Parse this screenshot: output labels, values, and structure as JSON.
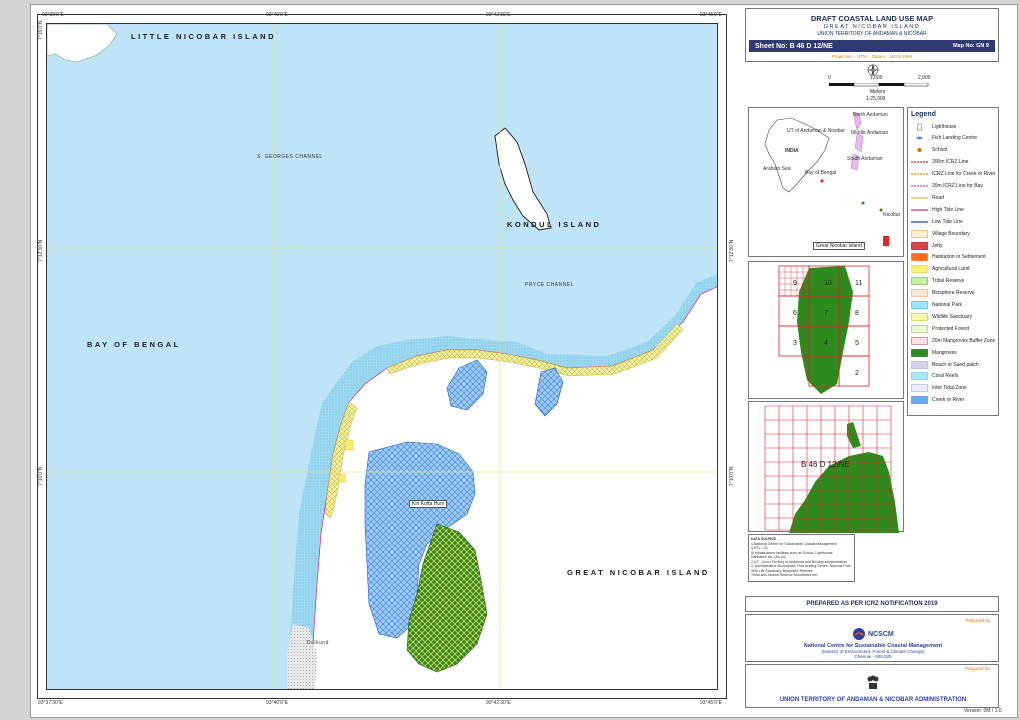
{
  "header": {
    "title": "DRAFT COASTAL LAND USE MAP",
    "island": "GREAT NICOBAR ISLAND",
    "territory": "UNION TERRITORY OF ANDAMAN & NICOBAR",
    "sheet_no": "Sheet No: B 46 D 12/NE",
    "map_no": "Map No: GN 9",
    "projection": "Projection :- UTM",
    "datum": "Datum :- WGS 1984"
  },
  "scale": {
    "ticks": [
      "0",
      "1,000",
      "2,000"
    ],
    "unit": "Meters",
    "ratio": "1:25,000"
  },
  "frame_ticks": {
    "top": [
      "93°39'0\"E",
      "93°40'0\"E",
      "93°42'30\"E",
      "93°45'0\"E"
    ],
    "bottom": [
      "93°37'30\"E",
      "93°40'0\"E",
      "93°42'30\"E",
      "93°45'0\"E"
    ],
    "left": [
      "7°10'0\"N",
      "7°12'30\"N",
      "7°15'0\"N"
    ],
    "right": [
      "7°10'0\"N",
      "7°12'30\"N",
      "7°15'0\"N"
    ]
  },
  "map_labels": {
    "little_nicobar": "LITTLE NICOBAR ISLAND",
    "s_georges": "S. GEORGES CHANNEL",
    "kondul": "KONDUL ISLAND",
    "pryce": "PRYCE CHANNEL",
    "bay_of_bengal": "BAY OF BENGAL",
    "great_nicobar": "GREAT NICOBAR ISLAND",
    "kirawati": "Kiri Kotta Huni",
    "dalkand": "Dalkund"
  },
  "locator": {
    "north_andaman": "North Andaman",
    "middle_andaman": "Middle Andaman",
    "south_andaman": "South Andaman",
    "ut_label": "UT of Andaman & Nicobar",
    "india": "INDIA",
    "arabian_sea": "Arabian Sea",
    "bay_of_bengal": "Bay of Bengal",
    "nicobar": "Nicobar",
    "great_nicobar": "Great Nicobar Island"
  },
  "legend": {
    "title": "Legend",
    "items": [
      {
        "label": "Lighthouse",
        "kind": "icon-lighthouse"
      },
      {
        "label": "Fish Landing Centre",
        "kind": "icon-fish"
      },
      {
        "label": "School",
        "kind": "icon-school"
      },
      {
        "label": "200m ICRZ Line",
        "kind": "line",
        "color": "#e0252b",
        "dash": "2,1"
      },
      {
        "label": "ICRZ Line for Creek or River",
        "kind": "line",
        "color": "#f08a00",
        "dash": "2,1"
      },
      {
        "label": "20m ICRZ Line for Bay",
        "kind": "line",
        "color": "#d040c0",
        "dash": "2,1"
      },
      {
        "label": "Road",
        "kind": "line",
        "color": "#e8b060",
        "dash": ""
      },
      {
        "label": "High Tide Line",
        "kind": "line",
        "color": "#d020a0",
        "dash": ""
      },
      {
        "label": "Low Tide Line",
        "kind": "line",
        "color": "#2040c0",
        "dash": ""
      },
      {
        "label": "Village Boundary",
        "kind": "fill",
        "color": "#fff3d0",
        "stroke": "#e8a040"
      },
      {
        "label": "Jetty",
        "kind": "fill",
        "color": "#e04040",
        "stroke": "#a00000"
      },
      {
        "label": "Habitation or Settlement",
        "kind": "fill",
        "color": "#ff6a1a",
        "stroke": "#ff6a1a"
      },
      {
        "label": "Agricultural Land",
        "kind": "fill",
        "color": "#fff170",
        "stroke": "#e0d040"
      },
      {
        "label": "Tribal Reserve",
        "kind": "fill",
        "color": "#c8f0a0",
        "stroke": "#60b040"
      },
      {
        "label": "Biosphere Reserve",
        "kind": "fill",
        "color": "#fde8d8",
        "stroke": "#f0a080"
      },
      {
        "label": "National Park",
        "kind": "fill",
        "color": "#a8e0ff",
        "stroke": "#40a0e0"
      },
      {
        "label": "Wildlife Sanctuary",
        "kind": "fill",
        "color": "#f8f8b0",
        "stroke": "#c8c040"
      },
      {
        "label": "Protected Forest",
        "kind": "fill",
        "color": "#e8f8d0",
        "stroke": "#90c060"
      },
      {
        "label": "20m Mangroves Buffer Zone",
        "kind": "fill",
        "color": "#fce0e8",
        "stroke": "#c06080"
      },
      {
        "label": "Mangroves",
        "kind": "fill",
        "color": "#2f8a1e",
        "stroke": "#1a5a10"
      },
      {
        "label": "Beach or Sand patch",
        "kind": "fill",
        "color": "#d8d0e8",
        "stroke": "#b0a8c8"
      },
      {
        "label": "Coral Reefs",
        "kind": "fill",
        "color": "#a8e8f8",
        "stroke": "#60c0e0"
      },
      {
        "label": "Inter Tidal Zone",
        "kind": "fill",
        "color": "#e8eef8",
        "stroke": "#a0b0d0"
      },
      {
        "label": "Creek or River",
        "kind": "fill",
        "color": "#6aaaf0",
        "stroke": "#4080d0"
      }
    ]
  },
  "index_grid": {
    "numbers": [
      "9",
      "10",
      "11",
      "6",
      "7",
      "8",
      "3",
      "4",
      "5",
      "2"
    ],
    "current_sheet": "B 46 D 12/NE"
  },
  "data_source": {
    "title": "DATA SOURCE",
    "lines": [
      "1.National Centre for Sustainable Coastal Management",
      "   i) HTL, LTL",
      "   ii) Infrastructure facilities such as School, Lighthouse,",
      "       Habitation etc. (As-on)",
      "2.UT - Union Territory of Andaman and Nicobar administration",
      "3. Administrative Boundaries, Fish landing Centre, National Park,",
      "   Wild Life Sanctuary, Biosphere Reserve",
      "   Tribal and Jarawa Reserve Boundaries etc."
    ]
  },
  "prepared": {
    "notification": "PREPARED AS PER ICRZ NOTIFICATION 2019",
    "prepared_by": "Prepared by",
    "logo_text": "NCSCM",
    "org_name": "National Centre for Sustainable Coastal Management",
    "ministry": "(Ministry of Environment, Forest & Climate Change)",
    "city": "Chennai - 600 025",
    "prepared_for": "Prepared for",
    "ut_admin": "UNION TERRITORY OF ANDAMAN & NICOBAR ADMINISTRATION",
    "version": "Version: 0M / 1.0"
  }
}
